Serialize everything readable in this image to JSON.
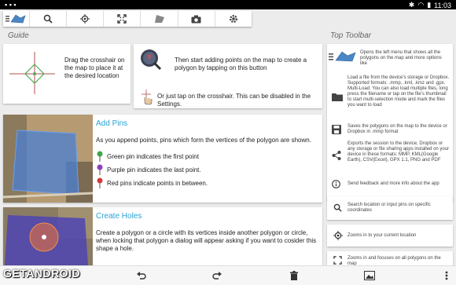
{
  "status": {
    "time": "11:03"
  },
  "guide": {
    "title": "Guide",
    "crosshair_text": "Drag the crosshair on the map to place it at the desired location",
    "add_points_text": "Then start adding points on the map to create a polygon by tapping on this button",
    "tap_text": "Or just tap on the crosshair. This can be disabled in the Settings.",
    "add_pins": {
      "heading": "Add Pins",
      "intro": "As you append points, pins which form the vertices of the polygon are shown.",
      "green": "Green pin indicates the first point",
      "purple": "Purple pin indicates the last point.",
      "red": "Red pins indicate points in between."
    },
    "create_holes": {
      "heading": "Create Holes",
      "text": "Create a polygon or a circle with its vertices inside another polygon or circle, when locking that polygon a dialog will appear asking if you want to cosider this shape a hole."
    }
  },
  "top_toolbar": {
    "title": "Top Toolbar",
    "menu_text": "Opens the left menu that shows all the polygons on the map and more options like",
    "load_text": "Load a file from the device's storage or Dropbox. Supported formats: .mmp, .kml, .kmz and .gpx. Multi-Load: You can also load multiple files, long press the filename or tap on the file's thumbnail to start multi-selection mode and mark the files you want to load",
    "save_text": "Saves the polygons on the map to the device or Dropbox in .mmp format",
    "export_text": "Exports the session to the device, Dropbox or any storage or file sharing apps installed on your device in these formats: MMP, KML(Google Earth), CSV(Excel), GPX 1.1, PNG and PDF",
    "feedback_text": "Send feedback and more info about the app",
    "search_text": "Search location or input pins on specific coordinates",
    "location_text": "Zooms in to your current location",
    "zoom_text": "Zooms in and focuses on all polygons on the map"
  },
  "watermark": "GETANDROID"
}
